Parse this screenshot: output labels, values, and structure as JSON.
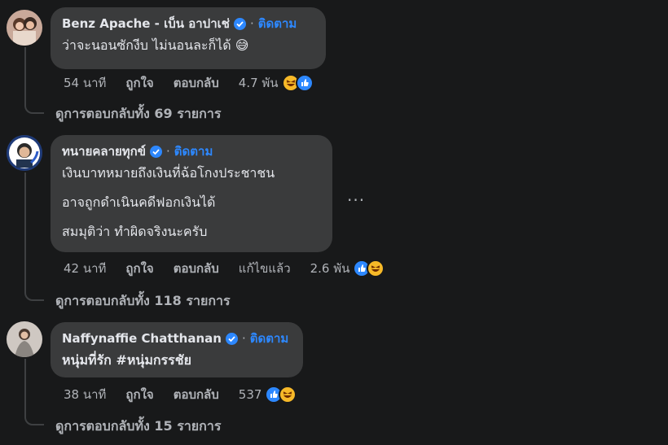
{
  "comments": [
    {
      "name": "Benz Apache - เบ็น อาปาเช่",
      "follow": "ติดตาม",
      "text": [
        "ว่าจะนอนซักงีบ ไม่นอนละก็ได้ 😅"
      ],
      "time": "54 นาที",
      "like": "ถูกใจ",
      "reply": "ตอบกลับ",
      "edited": "",
      "reaction_count": "4.7 พัน",
      "reactions": [
        "haha-icon",
        "like-icon"
      ],
      "view_replies": "ดูการตอบกลับทั้ง 69 รายการ"
    },
    {
      "name": "ทนายคลายทุกข์",
      "follow": "ติดตาม",
      "text": [
        "เงินบาทหมายถึงเงินที่ฉ้อโกงประชาชน",
        "อาจถูกดำเนินคดีฟอกเงินได้",
        "สมมุติว่า ทำผิดจริงนะครับ"
      ],
      "time": "42 นาที",
      "like": "ถูกใจ",
      "reply": "ตอบกลับ",
      "edited": "แก้ไขแล้ว",
      "reaction_count": "2.6 พัน",
      "reactions": [
        "like-icon",
        "haha-icon"
      ],
      "view_replies": "ดูการตอบกลับทั้ง 118 รายการ",
      "more": "..."
    },
    {
      "name": "Naffynaffie Chatthanan",
      "follow": "ติดตาม",
      "text": [
        "หนุ่มที่รัก #หนุ่มกรรชัย"
      ],
      "time": "38 นาที",
      "like": "ถูกใจ",
      "reply": "ตอบกลับ",
      "edited": "",
      "reaction_count": "537",
      "reactions": [
        "like-icon",
        "haha-icon"
      ],
      "view_replies": "ดูการตอบกลับทั้ง 15 รายการ"
    }
  ],
  "colors": {
    "background": "#18191a",
    "bubble": "#3a3b3c",
    "accent": "#2d88ff",
    "muted": "#b0b3b8",
    "haha": "#f7b928"
  }
}
